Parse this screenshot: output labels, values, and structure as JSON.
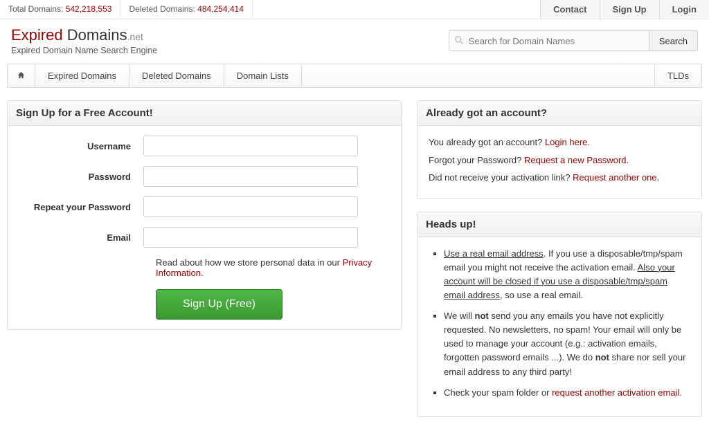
{
  "topbar": {
    "total_label": "Total Domains: ",
    "total_value": "542,218,553",
    "deleted_label": "Deleted Domains: ",
    "deleted_value": "484,254,414",
    "contact": "Contact",
    "signup": "Sign Up",
    "login": "Login"
  },
  "brand": {
    "word1": "Expired",
    "word2": " Domains",
    "tld": ".net",
    "sub": "Expired Domain Name Search Engine"
  },
  "search": {
    "placeholder": "Search for Domain Names",
    "button": "Search"
  },
  "nav": {
    "expired": "Expired Domains",
    "deleted": "Deleted Domains",
    "lists": "Domain Lists",
    "tlds": "TLDs"
  },
  "signup_panel": {
    "title": "Sign Up for a Free Account!",
    "username": "Username",
    "password": "Password",
    "repeat": "Repeat your Password",
    "email": "Email",
    "note_pre": "Read about how we store personal data in our ",
    "note_link": "Privacy Information",
    "note_post": ".",
    "button": "Sign Up (Free)"
  },
  "account_panel": {
    "title": "Already got an account?",
    "l1_pre": "You already got an account? ",
    "l1_link": "Login here",
    "l1_post": ".",
    "l2_pre": "Forgot your Password? ",
    "l2_link": "Request a new Password",
    "l2_post": ".",
    "l3_pre": "Did not receive your activation link? ",
    "l3_link": "Request another one",
    "l3_post": "."
  },
  "heads_panel": {
    "title": "Heads up!",
    "li1_u1": "Use a real email address",
    "li1_t1": ". If you use a disposable/tmp/spam email you might not receive the activation email. ",
    "li1_u2": "Also your account will be closed if you use a disposable/tmp/spam email address",
    "li1_t2": ", so use a real email.",
    "li2_t1": "We will ",
    "li2_b1": "not",
    "li2_t2": " send you any emails you have not explicitly requested. No newsletters, no spam! Your email will only be used to manage your account (e.g.: activation emails, forgotten password emails ...). We do ",
    "li2_b2": "not",
    "li2_t3": " share nor sell your email address to any third party!",
    "li3_t1": "Check your spam folder or ",
    "li3_link": "request another activation email",
    "li3_t2": "."
  }
}
